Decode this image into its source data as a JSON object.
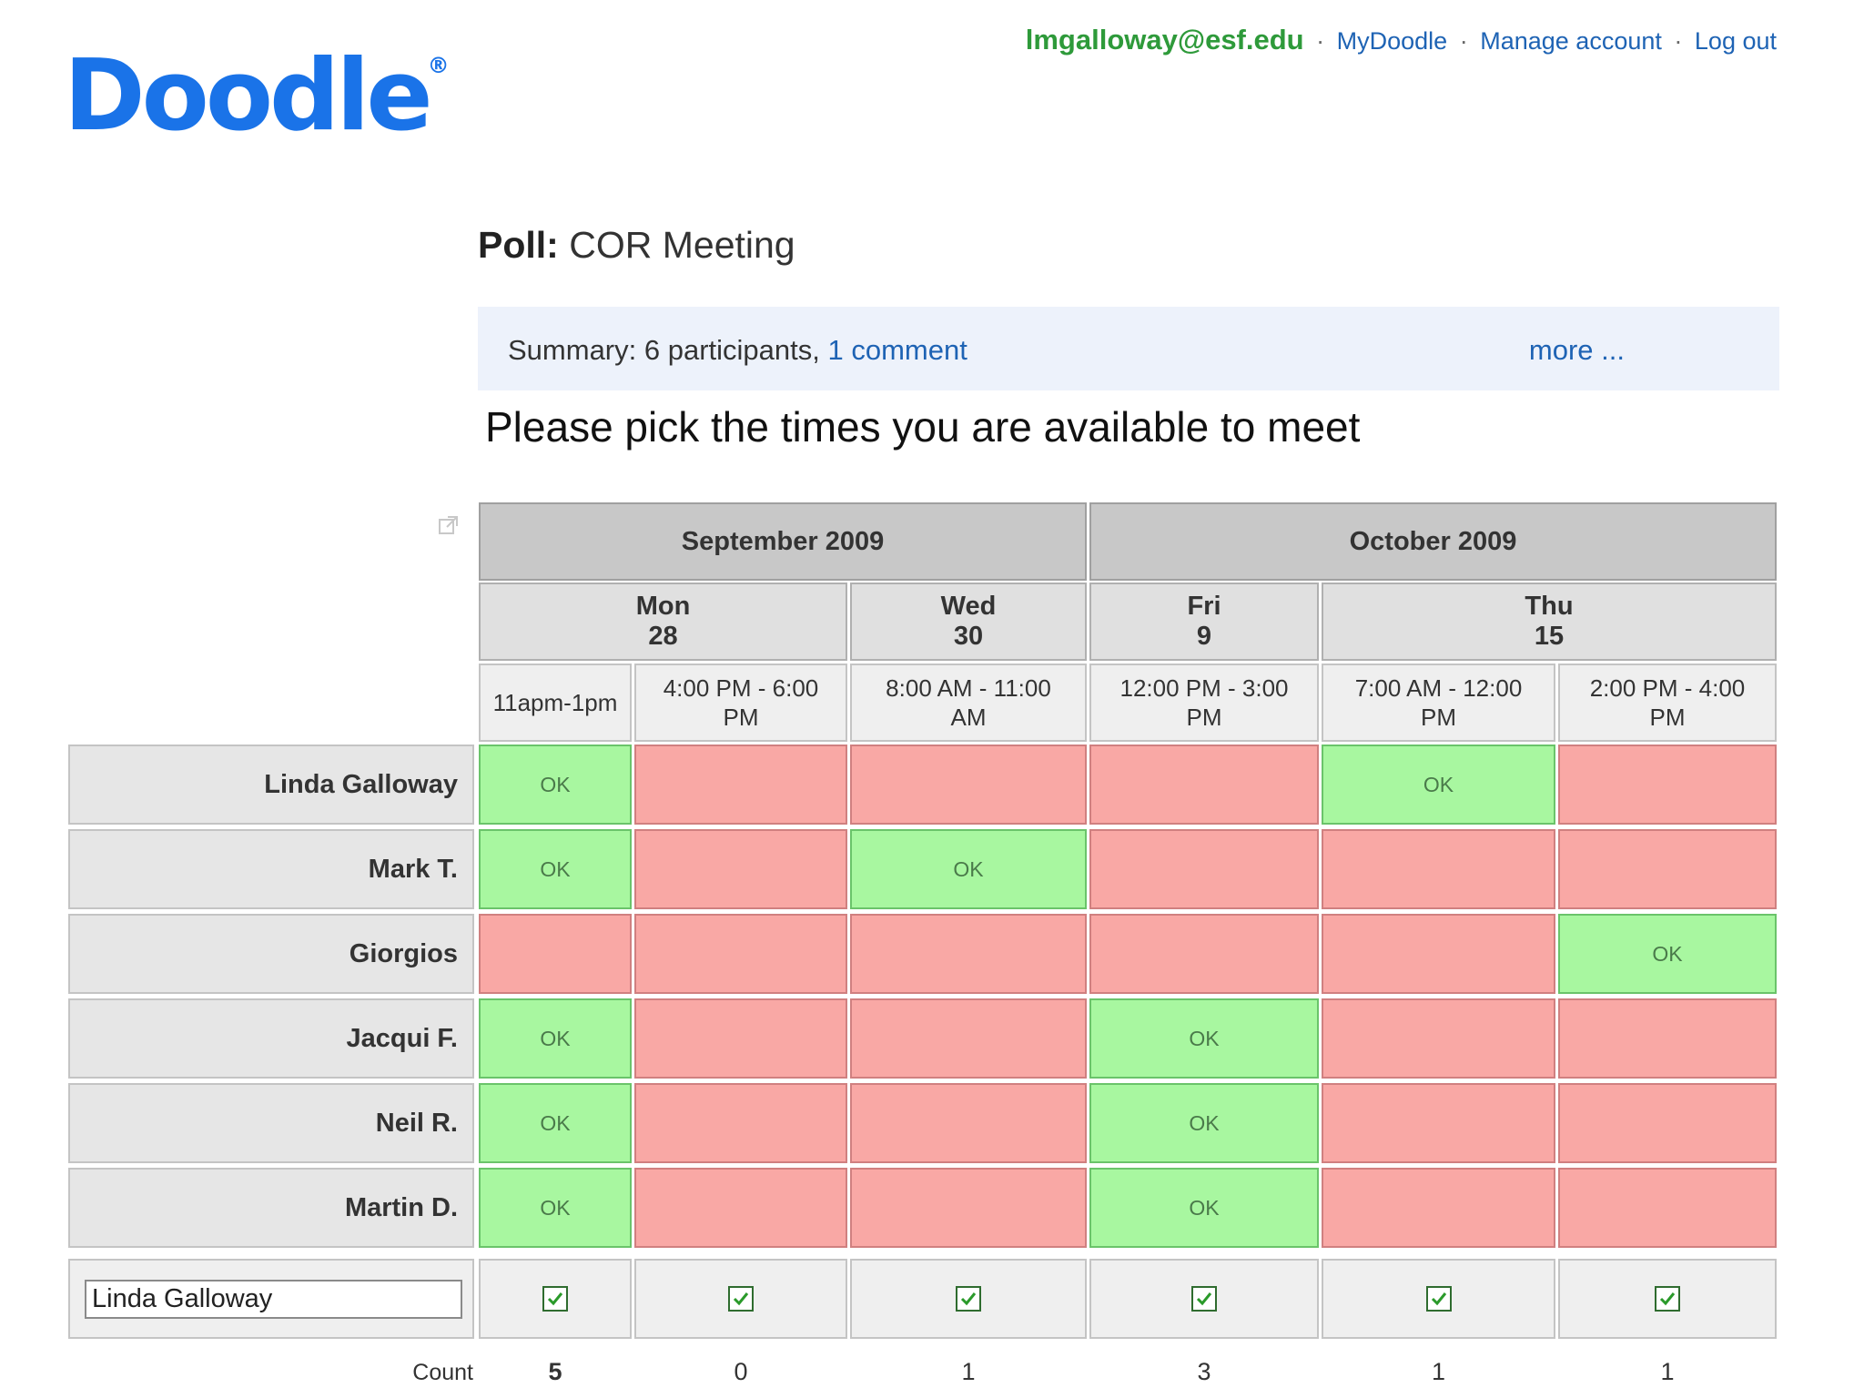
{
  "logo": {
    "text": "Doodle",
    "reg": "®"
  },
  "account": {
    "email": "lmgalloway@esf.edu",
    "separator": "·",
    "links": [
      "MyDoodle",
      "Manage account",
      "Log out"
    ]
  },
  "poll": {
    "label": "Poll:",
    "name": "COR Meeting"
  },
  "summary": {
    "prefix": "Summary: 6 participants,",
    "comment_link": "1 comment",
    "more_link": "more ..."
  },
  "instruction": "Please pick the times you are available to meet",
  "months": [
    {
      "label": "September 2009"
    },
    {
      "label": "October 2009"
    }
  ],
  "days": [
    {
      "label": "Mon\n28"
    },
    {
      "label": "Wed\n30"
    },
    {
      "label": "Fri\n9"
    },
    {
      "label": "Thu\n15"
    }
  ],
  "times": [
    {
      "label": "11apm-1pm"
    },
    {
      "label": "4:00 PM - 6:00\nPM"
    },
    {
      "label": "8:00 AM - 11:00\nAM"
    },
    {
      "label": "12:00 PM - 3:00\nPM"
    },
    {
      "label": "7:00 AM - 12:00\nPM"
    },
    {
      "label": "2:00 PM - 4:00\nPM"
    }
  ],
  "ok_text": "OK",
  "participants": [
    {
      "name": "Linda Galloway",
      "votes": [
        true,
        false,
        false,
        false,
        true,
        false
      ]
    },
    {
      "name": "Mark T.",
      "votes": [
        true,
        false,
        true,
        false,
        false,
        false
      ]
    },
    {
      "name": "Giorgios",
      "votes": [
        false,
        false,
        false,
        false,
        false,
        true
      ]
    },
    {
      "name": "Jacqui F.",
      "votes": [
        true,
        false,
        false,
        true,
        false,
        false
      ]
    },
    {
      "name": "Neil R.",
      "votes": [
        true,
        false,
        false,
        true,
        false,
        false
      ]
    },
    {
      "name": "Martin D.",
      "votes": [
        true,
        false,
        false,
        true,
        false,
        false
      ]
    }
  ],
  "new_entry": {
    "name_value": "Linda Galloway",
    "checked": [
      true,
      true,
      true,
      true,
      true,
      true
    ]
  },
  "count_label": "Count",
  "counts": [
    "5",
    "0",
    "1",
    "3",
    "1",
    "1"
  ],
  "colors": {
    "ok": "#a8f7a0",
    "not_ok": "#f9a8a5",
    "brand": "#1a73e8",
    "link": "#1e63b4",
    "email": "#2e9a3a"
  }
}
